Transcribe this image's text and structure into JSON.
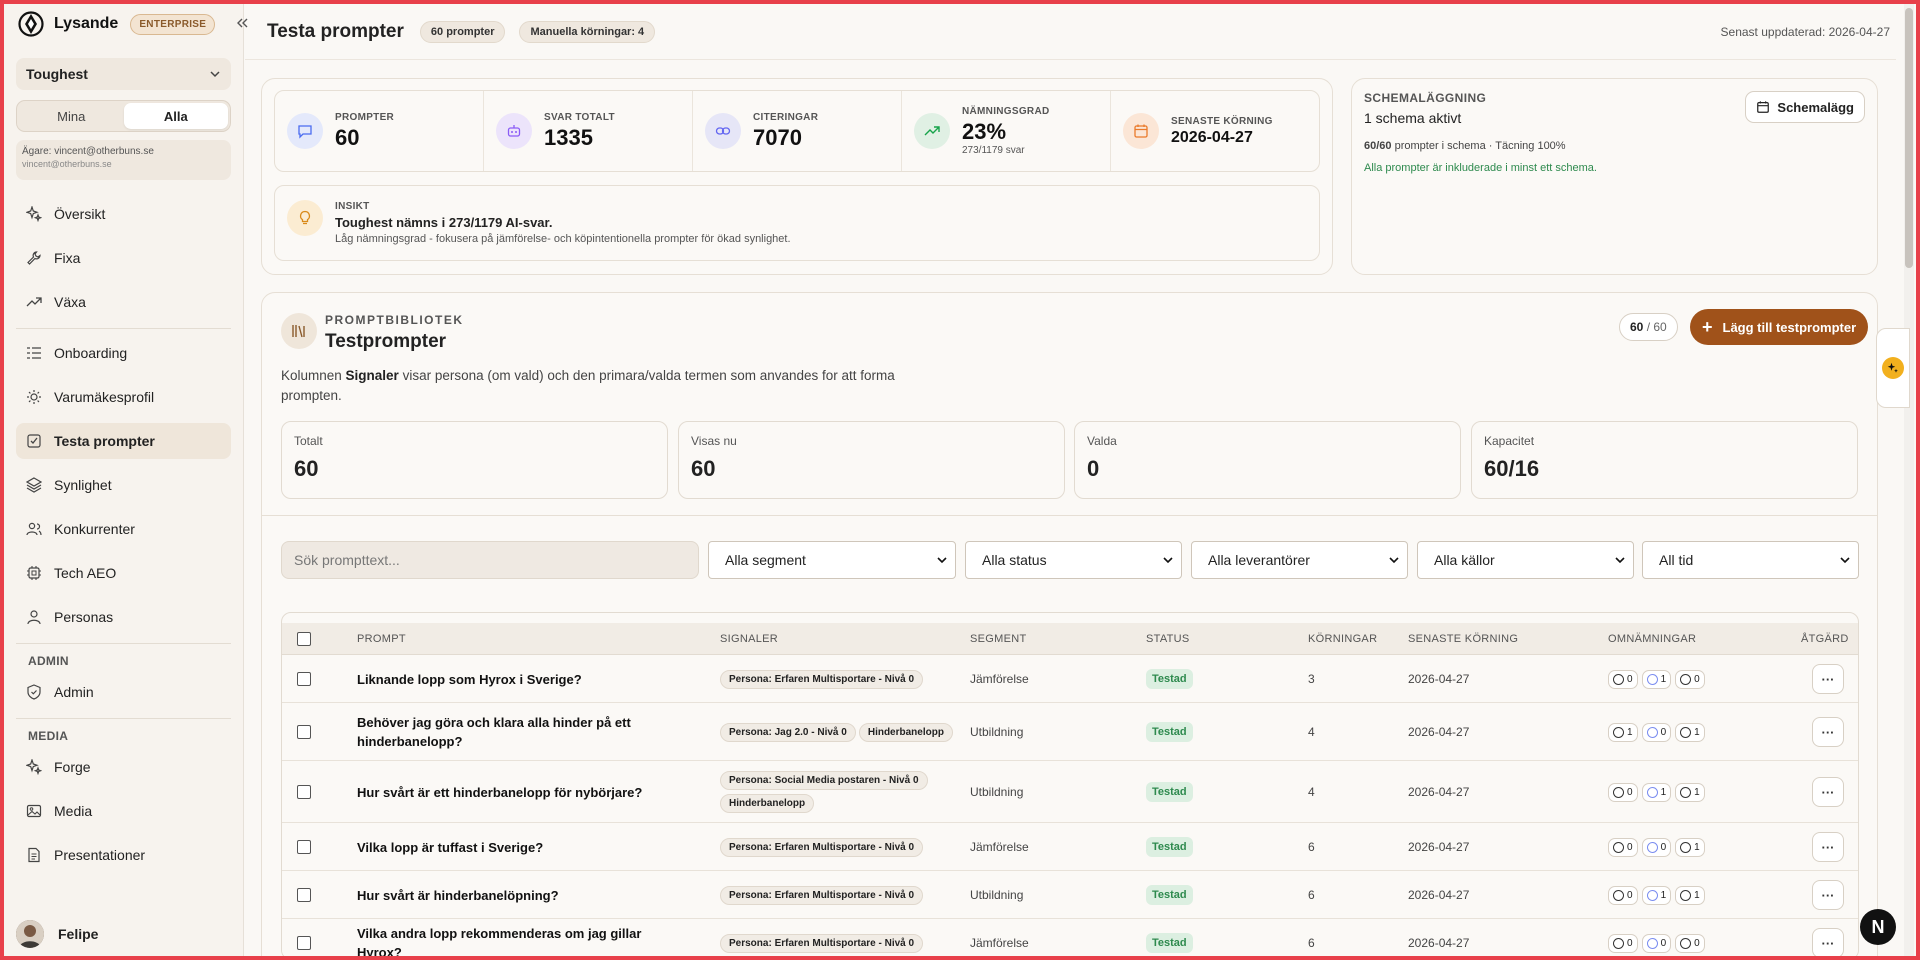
{
  "sidebar": {
    "brand": "Lysande",
    "tier": "ENTERPRISE",
    "workspace": "Toughest",
    "filter": {
      "mine": "Mina",
      "all": "Alla"
    },
    "owner_line": "Ägare: vincent@otherbuns.se",
    "owner_email": "vincent@otherbuns.se",
    "nav_main": [
      {
        "label": "Översikt",
        "icon": "sparkle-icon"
      },
      {
        "label": "Fixa",
        "icon": "wrench-icon"
      },
      {
        "label": "Växa",
        "icon": "trending-up-icon"
      }
    ],
    "nav_setup": [
      {
        "label": "Onboarding",
        "icon": "list-icon"
      },
      {
        "label": "Varumäkesprofil",
        "icon": "sun-icon"
      },
      {
        "label": "Testa prompter",
        "icon": "checkbox-icon",
        "active": true
      },
      {
        "label": "Synlighet",
        "icon": "layers-icon"
      },
      {
        "label": "Konkurrenter",
        "icon": "users-icon"
      },
      {
        "label": "Tech AEO",
        "icon": "chip-icon"
      },
      {
        "label": "Personas",
        "icon": "user-icon"
      }
    ],
    "admin_heading": "ADMIN",
    "admin_item": "Admin",
    "media_heading": "MEDIA",
    "nav_media": [
      {
        "label": "Forge",
        "icon": "sparkle-icon"
      },
      {
        "label": "Media",
        "icon": "image-icon"
      },
      {
        "label": "Presentationer",
        "icon": "document-icon"
      }
    ],
    "user": "Felipe"
  },
  "header": {
    "title": "Testa prompter",
    "pill_prompts": "60 prompter",
    "pill_runs": "Manuella körningar: 4",
    "updated": "Senast uppdaterad: 2026-04-27"
  },
  "stats": [
    {
      "label": "PROMPTER",
      "value": "60",
      "sub": "",
      "color": "#4a6cf0"
    },
    {
      "label": "SVAR TOTALT",
      "value": "1335",
      "sub": "",
      "color": "#8b5cf6"
    },
    {
      "label": "CITERINGAR",
      "value": "7070",
      "sub": "",
      "color": "#6366f1"
    },
    {
      "label": "NÄMNINGSGRAD",
      "value": "23%",
      "sub": "273/1179 svar",
      "color": "#16a34a"
    },
    {
      "label": "SENASTE KÖRNING",
      "value": "2026-04-27",
      "sub": "",
      "color": "#ea7a2a"
    }
  ],
  "insight": {
    "label": "INSIKT",
    "title": "Toughest nämns i 273/1179 AI-svar.",
    "text": "Låg nämningsgrad - fokusera på jämförelse- och köpintentionella prompter för ökad synlighet."
  },
  "schedule": {
    "label": "SCHEMALÄGGNING",
    "active": "1 schema aktivt",
    "coverage_count": "60/60",
    "coverage_text": "prompter i schema · Täcning 100%",
    "note": "Alla prompter är inkluderade i minst ett schema.",
    "button": "Schemalägg"
  },
  "library": {
    "kicker": "PROMPTBIBLIOTEK",
    "title": "Testprompter",
    "desc_pre": "Kolumnen ",
    "desc_bold": "Signaler",
    "desc_post": " visar persona (om vald) och den primara/valda termen som anvandes for att forma prompten.",
    "count_used": "60",
    "count_sep": " / ",
    "count_max": "60",
    "add_button": "Lägg till testprompter",
    "minis": [
      {
        "label": "Totalt",
        "value": "60"
      },
      {
        "label": "Visas nu",
        "value": "60"
      },
      {
        "label": "Valda",
        "value": "0"
      },
      {
        "label": "Kapacitet",
        "value": "60/16"
      }
    ]
  },
  "filters": {
    "search_placeholder": "Sök prompttext...",
    "segment": "Alla segment",
    "status": "Alla status",
    "providers": "Alla leverantörer",
    "sources": "Alla källor",
    "time": "All tid"
  },
  "table": {
    "headers": {
      "prompt": "PROMPT",
      "signals": "SIGNALER",
      "segment": "SEGMENT",
      "status": "STATUS",
      "runs": "KÖRNINGAR",
      "last": "SENASTE KÖRNING",
      "mentions": "OMNÄMNINGAR",
      "action": "ÅTGÄRD"
    },
    "rows": [
      {
        "prompt": "Liknande lopp som Hyrox i Sverige?",
        "signals": [
          "Persona: Erfaren Multisportare - Nivå 0"
        ],
        "segment": "Jämförelse",
        "status": "Testad",
        "runs": "3",
        "last": "2026-04-27",
        "mentions": [
          "0",
          "1",
          "0"
        ]
      },
      {
        "prompt": "Behöver jag göra och klara alla hinder på ett hinderbanelopp?",
        "signals": [
          "Persona: Jag 2.0 - Nivå 0",
          "Hinderbanelopp"
        ],
        "segment": "Utbildning",
        "status": "Testad",
        "runs": "4",
        "last": "2026-04-27",
        "mentions": [
          "1",
          "0",
          "1"
        ]
      },
      {
        "prompt": "Hur svårt är ett hinderbanelopp för nybörjare?",
        "signals": [
          "Persona: Social Media postaren - Nivå 0",
          "Hinderbanelopp"
        ],
        "segment": "Utbildning",
        "status": "Testad",
        "runs": "4",
        "last": "2026-04-27",
        "mentions": [
          "0",
          "1",
          "1"
        ]
      },
      {
        "prompt": "Vilka lopp är tuffast i Sverige?",
        "signals": [
          "Persona: Erfaren Multisportare - Nivå 0"
        ],
        "segment": "Jämförelse",
        "status": "Testad",
        "runs": "6",
        "last": "2026-04-27",
        "mentions": [
          "0",
          "0",
          "1"
        ]
      },
      {
        "prompt": "Hur svårt är hinderbanelöpning?",
        "signals": [
          "Persona: Erfaren Multisportare - Nivå 0"
        ],
        "segment": "Utbildning",
        "status": "Testad",
        "runs": "6",
        "last": "2026-04-27",
        "mentions": [
          "0",
          "1",
          "1"
        ]
      },
      {
        "prompt": "Vilka andra lopp rekommenderas om jag gillar Hyrox?",
        "signals": [
          "Persona: Erfaren Multisportare - Nivå 0"
        ],
        "segment": "Jämförelse",
        "status": "Testad",
        "runs": "6",
        "last": "2026-04-27",
        "mentions": [
          "0",
          "0",
          "0"
        ]
      }
    ]
  },
  "bubble_letter": "N"
}
